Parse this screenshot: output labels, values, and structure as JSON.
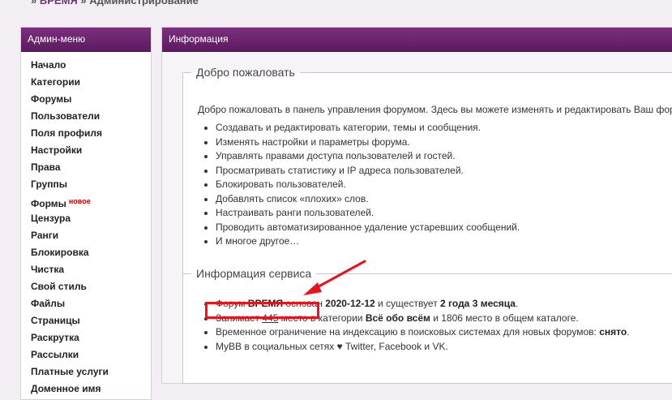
{
  "breadcrumb": {
    "separator": "»",
    "forum": "ВРЕМЯ",
    "section": "Администрирование"
  },
  "sidebar": {
    "title": "Админ-меню",
    "items": [
      {
        "label": "Начало"
      },
      {
        "label": "Категории"
      },
      {
        "label": "Форумы"
      },
      {
        "label": "Пользователи"
      },
      {
        "label": "Поля профиля"
      },
      {
        "label": "Настройки"
      },
      {
        "label": "Права"
      },
      {
        "label": "Группы"
      },
      {
        "label": "Формы",
        "badge": "новое"
      },
      {
        "label": "Цензура"
      },
      {
        "label": "Ранги"
      },
      {
        "label": "Блокировка"
      },
      {
        "label": "Чистка"
      },
      {
        "label": "Свой стиль"
      },
      {
        "label": "Файлы"
      },
      {
        "label": "Страницы"
      },
      {
        "label": "Раскрутка"
      },
      {
        "label": "Рассылки"
      },
      {
        "label": "Платные услуги"
      },
      {
        "label": "Доменное имя"
      }
    ]
  },
  "main": {
    "title": "Информация",
    "welcome": {
      "legend": "Добро пожаловать",
      "intro": "Добро пожаловать в панель управления форумом. Здесь вы можете изменять и редактировать Ваш форум.",
      "items": [
        "Создавать и редактировать категории, темы и сообщения.",
        "Изменять настройки и параметры форума.",
        "Управлять правами доступа пользователей и гостей.",
        "Просматривать статистику и IP адреса пользователей.",
        "Блокировать пользователей.",
        "Добавлять список «плохих» слов.",
        "Настраивать ранги пользователей.",
        "Проводить автоматизированное удаление устаревших сообщений.",
        "И многое другое…"
      ]
    },
    "service": {
      "legend": "Информация сервиса",
      "line1": {
        "t1": "Форум ",
        "forum": "ВРЕМЯ",
        "t2": " основан ",
        "date": "2020-12-12",
        "t3": " и существует ",
        "age": "2 года 3 месяца",
        "t4": "."
      },
      "line2": {
        "t1": "Занимает ",
        "rank": "445",
        "t2": " место в категории ",
        "category": "Всё обо всём",
        "t3": " и ",
        "total_rank": "1806",
        "t4": " место в общем каталоге."
      },
      "line3": {
        "t1": "Временное ограничение на индексацию в поисковых системах для новых форумов: ",
        "status": "снято",
        "t2": "."
      },
      "line4": {
        "t1": "MyBB в социальных сетях ♥ ",
        "twitter": "Twitter",
        "sep1": ", ",
        "facebook": "Facebook",
        "sep2": " и ",
        "vk": "VK",
        "t2": "."
      }
    }
  },
  "annotation": {
    "highlight_color": "#e8141c"
  }
}
